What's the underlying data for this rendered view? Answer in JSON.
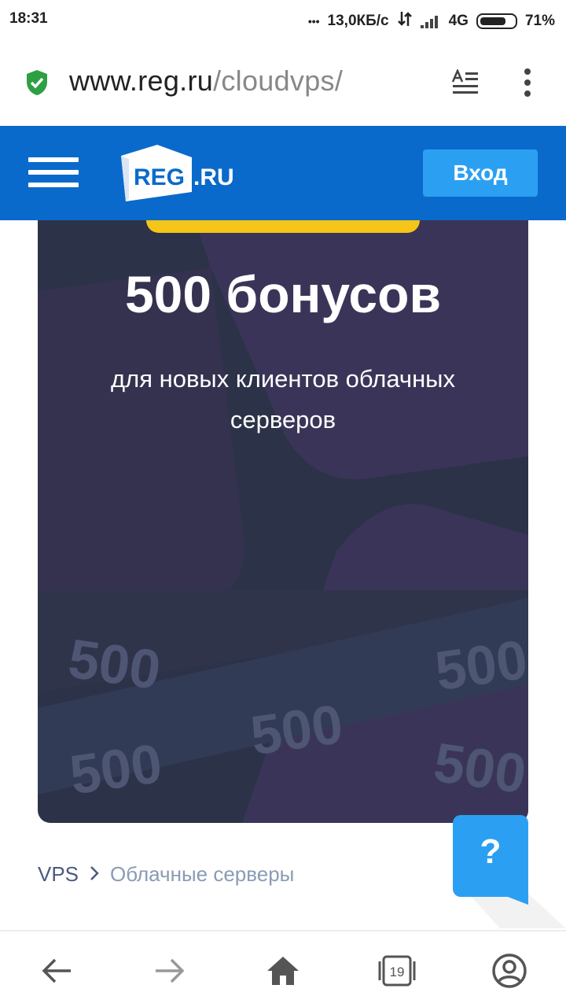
{
  "status_bar": {
    "time": "18:31",
    "dots": "•••",
    "speed": "13,0КБ/с",
    "network": "4G",
    "battery": "71%"
  },
  "browser": {
    "url_host": "www.reg.ru",
    "url_path": "/cloudvps/",
    "tabs_count": "19"
  },
  "site": {
    "logo_main": "REG",
    "logo_suffix": ".RU",
    "login_label": "Вход"
  },
  "banner": {
    "title": "500 бонусов",
    "subtitle": "для новых клиентов облачных серверов",
    "watermark": "500"
  },
  "breadcrumb": {
    "items": [
      "VPS",
      "Облачные серверы"
    ]
  },
  "help": {
    "label": "?"
  },
  "colors": {
    "header_bg": "#0a6acb",
    "login_bg": "#2ba0f2",
    "banner_bg": "#2c3247",
    "ribbon": "#f5c518",
    "help_bg": "#2ba0f2",
    "secure_green": "#2ea043"
  },
  "icons": {
    "secure": "shield-check-icon",
    "reader": "reader-mode-icon",
    "menu": "overflow-menu-icon",
    "burger": "hamburger-icon",
    "back": "arrow-left-icon",
    "forward": "arrow-right-icon",
    "home": "home-icon",
    "tabs": "tabs-icon",
    "profile": "profile-icon"
  }
}
